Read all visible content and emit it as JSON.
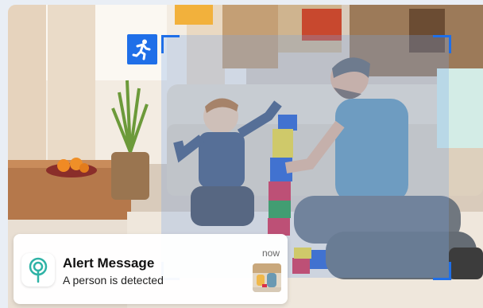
{
  "notification": {
    "title": "Alert Message",
    "message": "A person is detected",
    "time": "now"
  },
  "icons": {
    "motion": "person-running-icon",
    "app": "location-pin-icon"
  },
  "colors": {
    "accent": "#1f6fe8",
    "app_icon_teal": "#2fb3a6",
    "overlay": "#78a5eb"
  }
}
